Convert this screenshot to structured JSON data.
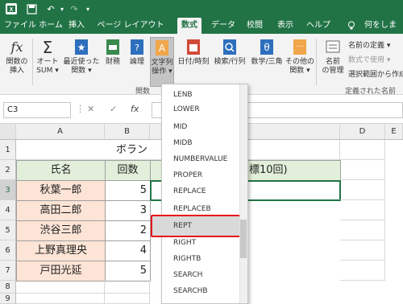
{
  "titlebar": {
    "undo_glyph": "↶",
    "redo_glyph": "↷",
    "dropdown_glyph": "▾"
  },
  "tabs": {
    "items": [
      "ファイル",
      "ホーム",
      "挿入",
      "ページ レイアウト",
      "数式",
      "データ",
      "校閲",
      "表示",
      "ヘルプ"
    ],
    "active": "数式",
    "tell_me": "何をします"
  },
  "ribbon": {
    "insert_function": "関数の\n挿入",
    "autosum": "オート\nSUM ▾",
    "recent": "最近使った\n関数 ▾",
    "financial": "財務",
    "logical": "論理",
    "text": "文字列\n操作 ▾",
    "datetime": "日付/時刻",
    "lookup": "検索/行列",
    "math": "数学/三角",
    "more": "その他の\n関数 ▾",
    "name_manager": "名前\nの管理",
    "define_name": "名前の定義 ▾",
    "use_in_formula": "数式で使用 ▾",
    "create_from_selection": "選択範囲から作成",
    "group_library": "関数",
    "group_names": "定義された名前"
  },
  "formula_bar": {
    "name_box": "C3",
    "cancel_glyph": "✕",
    "enter_glyph": "✓",
    "fx_glyph": "fx"
  },
  "grid": {
    "columns": [
      "A",
      "B",
      "C",
      "D",
      "E"
    ],
    "rows": [
      "1",
      "2",
      "3",
      "4",
      "5",
      "6",
      "7",
      "8",
      "9"
    ],
    "title_visible": "ボラン",
    "title_tail": "標10回)",
    "header_name": "氏名",
    "header_count": "回数",
    "names": [
      "秋葉一郎",
      "高田二郎",
      "渋谷三郎",
      "上野真理央",
      "戸田光延"
    ],
    "counts": [
      "5",
      "3",
      "2",
      "4",
      "5"
    ]
  },
  "menu": {
    "items": [
      "LENB",
      "LOWER",
      "MID",
      "MIDB",
      "NUMBERVALUE",
      "PROPER",
      "REPLACE",
      "REPLACEB",
      "REPT",
      "RIGHT",
      "RIGHTB",
      "SEARCH",
      "SEARCHB"
    ],
    "highlighted": "REPT"
  },
  "colors": {
    "excel_green": "#217346",
    "header_fill": "#e2efda",
    "name_fill": "#fce4d6",
    "highlight_border": "#e8121b"
  }
}
